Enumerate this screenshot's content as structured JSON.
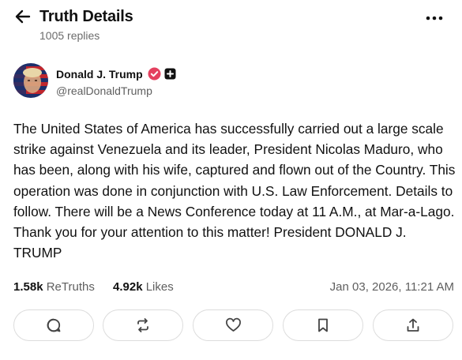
{
  "header": {
    "title": "Truth Details",
    "replies": "1005 replies"
  },
  "author": {
    "name": "Donald J. Trump",
    "handle": "@realDonaldTrump"
  },
  "post": {
    "text": "The United States of America has successfully carried out a large scale strike against Venezuela and its leader, President Nicolas Maduro, who has been, along with his wife, captured and flown out of the Country. This operation was done in conjunction with U.S. Law Enforcement. Details to follow. There will be a News Conference today at 11 A.M., at Mar-a-Lago. Thank you for your attention to this matter! President DONALD J. TRUMP"
  },
  "stats": {
    "retruths_count": "1.58k",
    "retruths_label": "ReTruths",
    "likes_count": "4.92k",
    "likes_label": "Likes",
    "timestamp": "Jan 03, 2026, 11:21 AM"
  },
  "actions": [
    {
      "icon": "reply-icon"
    },
    {
      "icon": "retruth-icon"
    },
    {
      "icon": "like-icon"
    },
    {
      "icon": "bookmark-icon"
    },
    {
      "icon": "share-icon"
    }
  ],
  "colors": {
    "verified_badge": "#e4405f",
    "muted_text": "#6b6b6b",
    "border": "#dcdcdc"
  }
}
